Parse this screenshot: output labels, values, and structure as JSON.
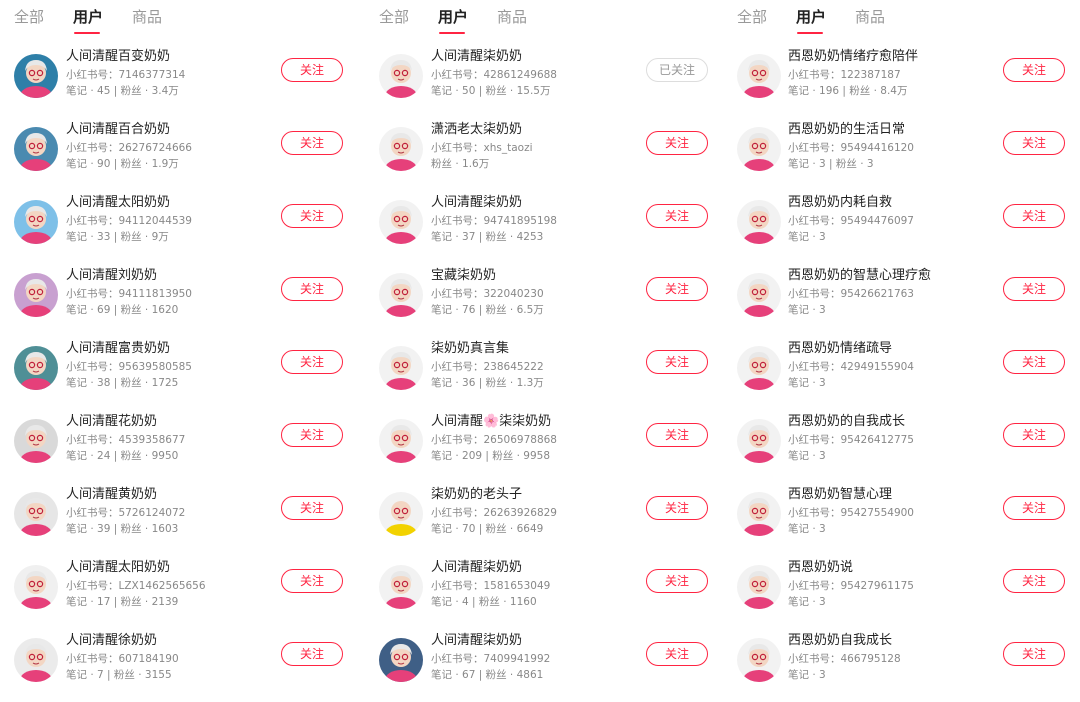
{
  "colors": {
    "accent": "#ff2442",
    "muted": "#888888",
    "tab_inactive": "#999999",
    "followed_border": "#dddddd"
  },
  "panels": [
    {
      "tabs": [
        "全部",
        "用户",
        "商品"
      ],
      "active_tab": 1,
      "users": [
        {
          "name": "人间清醒百变奶奶",
          "id": "小红书号：7146377314",
          "stats": "笔记 · 45 | 粉丝 · 3.4万",
          "button": "关注",
          "followed": false,
          "avatar_icon": "grandma-avatar-icon",
          "avatar_bg": "#2e7fa8"
        },
        {
          "name": "人间清醒百合奶奶",
          "id": "小红书号：26276724666",
          "stats": "笔记 · 90 | 粉丝 · 1.9万",
          "button": "关注",
          "followed": false,
          "avatar_icon": "grandma-avatar-icon",
          "avatar_bg": "#4a8ab0"
        },
        {
          "name": "人间清醒太阳奶奶",
          "id": "小红书号：94112044539",
          "stats": "笔记 · 33 | 粉丝 · 9万",
          "button": "关注",
          "followed": false,
          "avatar_icon": "grandma-avatar-icon",
          "avatar_bg": "#7ec0e8"
        },
        {
          "name": "人间清醒刘奶奶",
          "id": "小红书号：94111813950",
          "stats": "笔记 · 69 | 粉丝 · 1620",
          "button": "关注",
          "followed": false,
          "avatar_icon": "grandma-avatar-icon",
          "avatar_bg": "#c8a0d0"
        },
        {
          "name": "人间清醒富贵奶奶",
          "id": "小红书号：95639580585",
          "stats": "笔记 · 38 | 粉丝 · 1725",
          "button": "关注",
          "followed": false,
          "avatar_icon": "grandma-avatar-icon",
          "avatar_bg": "#4f8f96"
        },
        {
          "name": "人间清醒花奶奶",
          "id": "小红书号：4539358677",
          "stats": "笔记 · 24 | 粉丝 · 9950",
          "button": "关注",
          "followed": false,
          "avatar_icon": "grandma-avatar-icon",
          "avatar_bg": "#d9d9d9"
        },
        {
          "name": "人间清醒黄奶奶",
          "id": "小红书号：5726124072",
          "stats": "笔记 · 39 | 粉丝 · 1603",
          "button": "关注",
          "followed": false,
          "avatar_icon": "grandma-avatar-icon",
          "avatar_bg": "#e6e6e6"
        },
        {
          "name": "人间清醒太阳奶奶",
          "id": "小红书号：LZX1462565656",
          "stats": "笔记 · 17 | 粉丝 · 2139",
          "button": "关注",
          "followed": false,
          "avatar_icon": "grandma-avatar-icon",
          "avatar_bg": "#f0f0f0"
        },
        {
          "name": "人间清醒徐奶奶",
          "id": "小红书号：607184190",
          "stats": "笔记 · 7 | 粉丝 · 3155",
          "button": "关注",
          "followed": false,
          "avatar_icon": "grandma-avatar-icon",
          "avatar_bg": "#ebebeb"
        }
      ]
    },
    {
      "tabs": [
        "全部",
        "用户",
        "商品"
      ],
      "active_tab": 1,
      "users": [
        {
          "name": "人间清醒柒奶奶",
          "id": "小红书号：42861249688",
          "stats": "笔记 · 50 | 粉丝 · 15.5万",
          "button": "已关注",
          "followed": true,
          "avatar_icon": "grandma-avatar-icon",
          "avatar_bg": "#f2f2f2"
        },
        {
          "name": "潇洒老太柒奶奶",
          "id": "小红书号：xhs_taozi",
          "stats": "粉丝 · 1.6万",
          "button": "关注",
          "followed": false,
          "avatar_icon": "grandma-avatar-icon",
          "avatar_bg": "#f2f2f2"
        },
        {
          "name": "人间清醒柒奶奶",
          "id": "小红书号：94741895198",
          "stats": "笔记 · 37 | 粉丝 · 4253",
          "button": "关注",
          "followed": false,
          "avatar_icon": "grandma-avatar-icon",
          "avatar_bg": "#f2f2f2"
        },
        {
          "name": "宝藏柒奶奶",
          "id": "小红书号：322040230",
          "stats": "笔记 · 76 | 粉丝 · 6.5万",
          "button": "关注",
          "followed": false,
          "avatar_icon": "grandma-avatar-icon",
          "avatar_bg": "#f2f2f2"
        },
        {
          "name": "柒奶奶真言集",
          "id": "小红书号：238645222",
          "stats": "笔记 · 36 | 粉丝 · 1.3万",
          "button": "关注",
          "followed": false,
          "avatar_icon": "grandma-avatar-icon",
          "avatar_bg": "#f2f2f2"
        },
        {
          "name": "人间清醒🌸柒柒奶奶",
          "id": "小红书号：26506978868",
          "stats": "笔记 · 209 | 粉丝 · 9958",
          "button": "关注",
          "followed": false,
          "avatar_icon": "grandma-avatar-icon",
          "avatar_bg": "#f2f2f2"
        },
        {
          "name": "柒奶奶的老头子",
          "id": "小红书号：26263926829",
          "stats": "笔记 · 70 | 粉丝 · 6649",
          "button": "关注",
          "followed": false,
          "avatar_icon": "grandpa-avatar-icon",
          "avatar_bg": "#f2f2f2"
        },
        {
          "name": "人间清醒柒奶奶",
          "id": "小红书号：1581653049",
          "stats": "笔记 · 4 | 粉丝 · 1160",
          "button": "关注",
          "followed": false,
          "avatar_icon": "grandma-avatar-icon",
          "avatar_bg": "#f2f2f2"
        },
        {
          "name": "人间清醒柒奶奶",
          "id": "小红书号：7409941992",
          "stats": "笔记 · 67 | 粉丝 · 4861",
          "button": "关注",
          "followed": false,
          "avatar_icon": "grandma-avatar-icon",
          "avatar_bg": "#3f5f86"
        }
      ]
    },
    {
      "tabs": [
        "全部",
        "用户",
        "商品"
      ],
      "active_tab": 1,
      "users": [
        {
          "name": "西恩奶奶情绪疗愈陪伴",
          "id": "小红书号：122387187",
          "stats": "笔记 · 196 | 粉丝 · 8.4万",
          "button": "关注",
          "followed": false,
          "avatar_icon": "grandma-avatar-icon",
          "avatar_bg": "#f2f2f2"
        },
        {
          "name": "西恩奶奶的生活日常",
          "id": "小红书号：95494416120",
          "stats": "笔记 · 3 | 粉丝 · 3",
          "button": "关注",
          "followed": false,
          "avatar_icon": "grandma-avatar-icon",
          "avatar_bg": "#f2f2f2"
        },
        {
          "name": "西恩奶奶内耗自救",
          "id": "小红书号：95494476097",
          "stats": "笔记 · 3",
          "button": "关注",
          "followed": false,
          "avatar_icon": "grandma-avatar-icon",
          "avatar_bg": "#f2f2f2"
        },
        {
          "name": "西恩奶奶的智慧心理疗愈",
          "id": "小红书号：95426621763",
          "stats": "笔记 · 3",
          "button": "关注",
          "followed": false,
          "avatar_icon": "grandma-avatar-icon",
          "avatar_bg": "#f2f2f2"
        },
        {
          "name": "西恩奶奶情绪疏导",
          "id": "小红书号：42949155904",
          "stats": "笔记 · 3",
          "button": "关注",
          "followed": false,
          "avatar_icon": "grandma-avatar-icon",
          "avatar_bg": "#f2f2f2"
        },
        {
          "name": "西恩奶奶的自我成长",
          "id": "小红书号：95426412775",
          "stats": "笔记 · 3",
          "button": "关注",
          "followed": false,
          "avatar_icon": "grandma-avatar-icon",
          "avatar_bg": "#f2f2f2"
        },
        {
          "name": "西恩奶奶智慧心理",
          "id": "小红书号：95427554900",
          "stats": "笔记 · 3",
          "button": "关注",
          "followed": false,
          "avatar_icon": "grandma-avatar-icon",
          "avatar_bg": "#f2f2f2"
        },
        {
          "name": "西恩奶奶说",
          "id": "小红书号：95427961175",
          "stats": "笔记 · 3",
          "button": "关注",
          "followed": false,
          "avatar_icon": "grandma-avatar-icon",
          "avatar_bg": "#f2f2f2"
        },
        {
          "name": "西恩奶奶自我成长",
          "id": "小红书号：466795128",
          "stats": "笔记 · 3",
          "button": "关注",
          "followed": false,
          "avatar_icon": "grandma-avatar-icon",
          "avatar_bg": "#f2f2f2"
        }
      ]
    }
  ]
}
